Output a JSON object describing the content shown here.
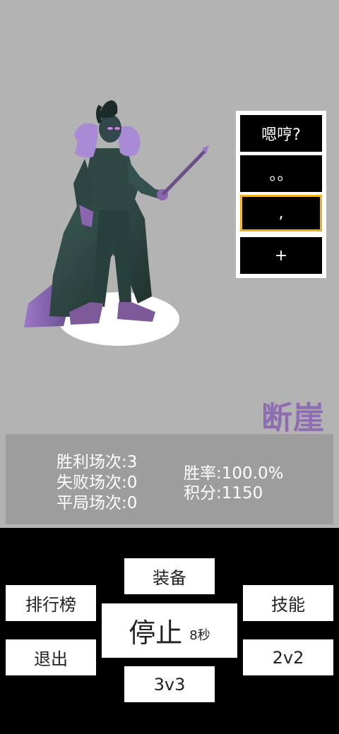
{
  "character": {
    "name": "断崖"
  },
  "emotes": [
    "嗯哼?",
    "。。",
    ",",
    "+"
  ],
  "stats": {
    "wins_label": "胜利场次:",
    "wins": "3",
    "losses_label": "失败场次:",
    "losses": "0",
    "draws_label": "平局场次:",
    "draws": "0",
    "winrate_label": "胜率:",
    "winrate": "100.0%",
    "score_label": "积分:",
    "score": "1150"
  },
  "controls": {
    "equipment": "装备",
    "leaderboard": "排行榜",
    "skills": "技能",
    "stop": "停止",
    "timer": "8秒",
    "exit": "退出",
    "mode_2v2": "2v2",
    "mode_3v3": "3v3"
  },
  "colors": {
    "name_color": "#8e6db0",
    "selected_border": "#f2b21c",
    "background": "#b3b3b3"
  }
}
